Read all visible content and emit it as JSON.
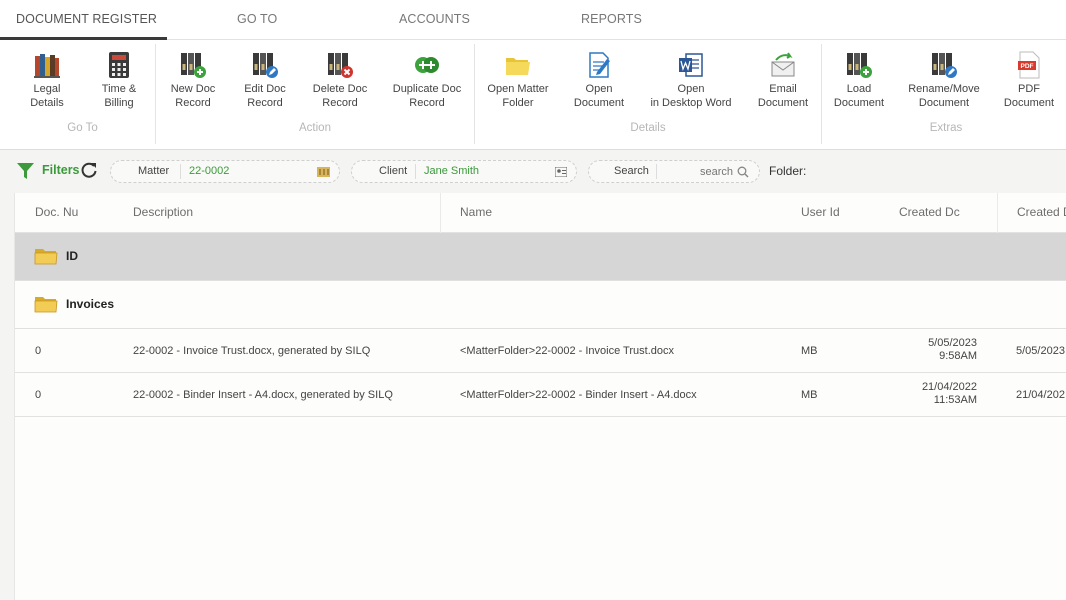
{
  "tabs": [
    {
      "label": "DOCUMENT REGISTER"
    },
    {
      "label": "GO TO"
    },
    {
      "label": "ACCOUNTS"
    },
    {
      "label": "REPORTS"
    }
  ],
  "ribbon": {
    "goto": {
      "group_label": "Go To",
      "legal_details": "Legal\nDetails",
      "time_billing": "Time &\nBilling"
    },
    "action": {
      "group_label": "Action",
      "new_doc": "New Doc\nRecord",
      "edit_doc": "Edit Doc\nRecord",
      "delete_doc": "Delete Doc\nRecord",
      "duplicate_doc": "Duplicate Doc\nRecord"
    },
    "details": {
      "group_label": "Details",
      "open_matter_folder": "Open Matter\nFolder",
      "open_document": "Open\nDocument",
      "open_desktop_word": "Open\nin Desktop Word",
      "email_document": "Email\nDocument"
    },
    "extras": {
      "group_label": "Extras",
      "load_document": "Load\nDocument",
      "rename_move": "Rename/Move\nDocument",
      "pdf_document": "PDF\nDocument",
      "pdf_badge": "PDF"
    }
  },
  "filters": {
    "label": "Filters",
    "matter_label": "Matter",
    "matter_value": "22-0002",
    "client_label": "Client",
    "client_value": "Jane Smith",
    "search_label": "Search",
    "search_placeholder": "search",
    "folder_label": "Folder:"
  },
  "grid": {
    "columns": [
      "Doc. Nu",
      "Description",
      "Name",
      "User Id",
      "Created Dc",
      "Created D"
    ],
    "groups": [
      {
        "label": "ID"
      },
      {
        "label": "Invoices"
      }
    ],
    "rows": [
      {
        "doc_no": "0",
        "description": "22-0002 - Invoice Trust.docx, generated by SILQ",
        "name": "<MatterFolder>22-0002 - Invoice Trust.docx",
        "user_id": "MB",
        "created_date": "5/05/2023",
        "created_time": "9:58AM",
        "created2": "5/05/2023"
      },
      {
        "doc_no": "0",
        "description": "22-0002 - Binder Insert - A4.docx, generated by SILQ",
        "name": "<MatterFolder>22-0002 - Binder Insert - A4.docx",
        "user_id": "MB",
        "created_date": "21/04/2022",
        "created_time": "11:53AM",
        "created2": "21/04/202"
      }
    ]
  },
  "colors": {
    "accent_green": "#3c9a3c",
    "selected_row": "#d6d6d6"
  }
}
